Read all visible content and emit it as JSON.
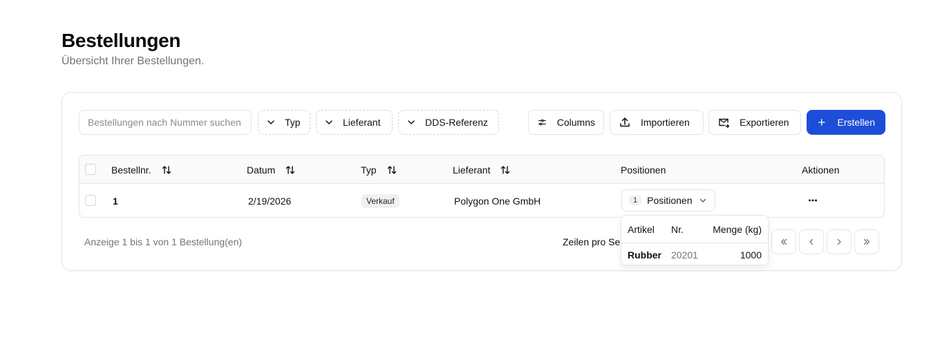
{
  "header": {
    "title": "Bestellungen",
    "subtitle": "Übersicht Ihrer Bestellungen."
  },
  "toolbar": {
    "search_placeholder": "Bestellungen nach Nummer suchen",
    "filters": [
      "Typ",
      "Lieferant",
      "DDS-Referenz"
    ],
    "columns_label": "Columns",
    "import_label": "Importieren",
    "export_label": "Exportieren",
    "create_label": "Erstellen"
  },
  "table": {
    "columns": [
      "Bestellnr.",
      "Datum",
      "Typ",
      "Lieferant",
      "Positionen",
      "Aktionen"
    ],
    "rows": [
      {
        "number": "1",
        "date": "2/19/2026",
        "type": "Verkauf",
        "supplier": "Polygon One GmbH",
        "positions_count": "1",
        "positions_label": "Positionen"
      }
    ]
  },
  "popover": {
    "columns": [
      "Artikel",
      "Nr.",
      "Menge (kg)"
    ],
    "rows": [
      {
        "article": "Rubber",
        "number": "20201",
        "quantity": "1000"
      }
    ]
  },
  "footer": {
    "summary": "Anzeige 1 bis 1 von 1 Bestellung(en)",
    "rows_per_page_label": "Zeilen pro Se"
  },
  "colors": {
    "primary": "#1d4ed8",
    "border": "#e5e5e5",
    "muted_text": "#737373"
  }
}
